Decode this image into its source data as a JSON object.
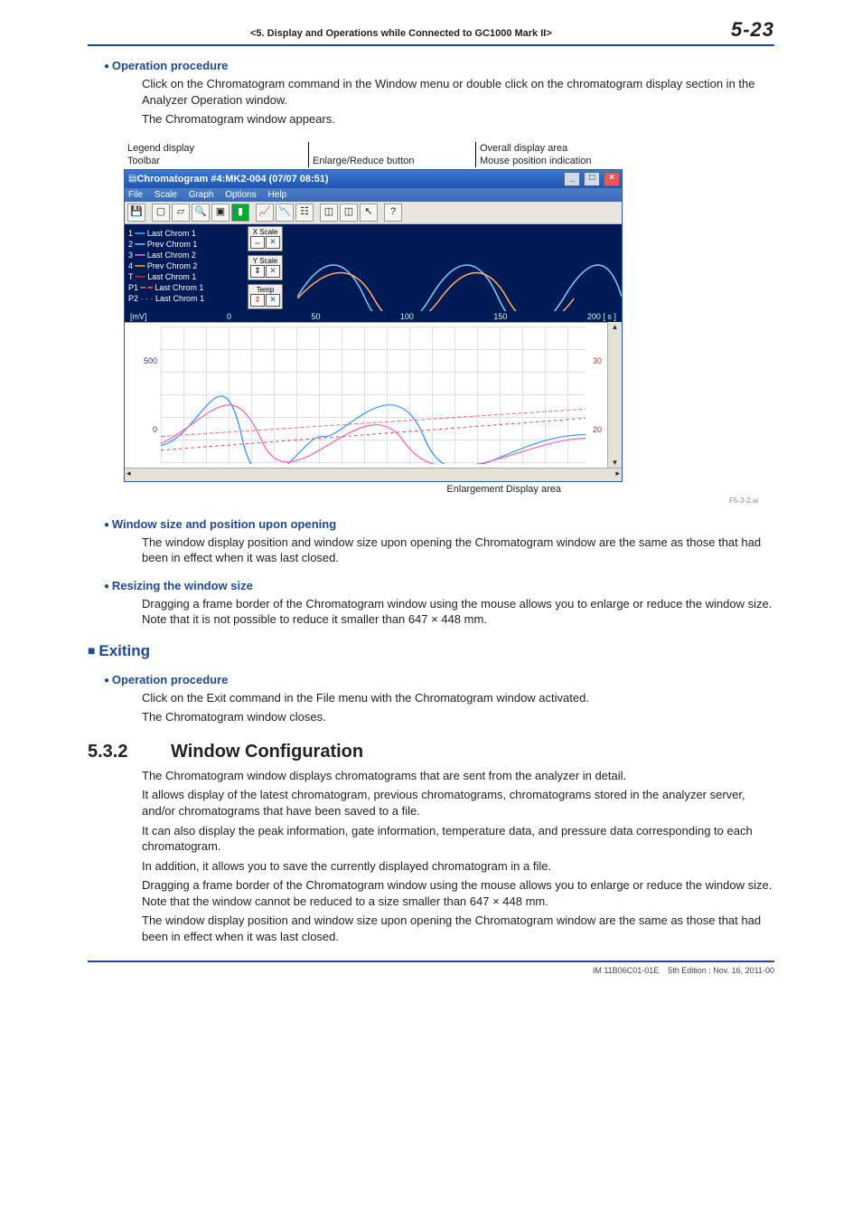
{
  "header": {
    "chapter": "<5.  Display and Operations while Connected to GC1000 Mark II>",
    "page": "5-23"
  },
  "s_op1": {
    "title": "Operation procedure",
    "p1": "Click on the Chromatogram command in the Window menu or double click on the chromatogram display section in the Analyzer Operation window.",
    "p2": "The Chromatogram window appears."
  },
  "callout": {
    "legend_display": "Legend display",
    "toolbar": "Toolbar",
    "enlarge_reduce": "Enlarge/Reduce button",
    "overall": "Overall display area",
    "mouse": "Mouse position indication",
    "enlarge_area": "Enlargement Display area"
  },
  "win": {
    "title": "Chromatogram #4:MK2-004 (07/07 08:51)",
    "menu": {
      "file": "File",
      "scale": "Scale",
      "graph": "Graph",
      "options": "Options",
      "help": "Help"
    },
    "scale": {
      "xscale": "X Scale",
      "yscale": "Y Scale",
      "temp": "Temp"
    },
    "legend": {
      "i1": "Last Chrom 1",
      "i2": "Prev Chrom 1",
      "i3": "Last Chrom 2",
      "i4": "Prev Chrom 2",
      "iT": "Last Chrom 1",
      "iP1": "Last Chrom 1",
      "iP2": "Last Chrom 1",
      "n1": "1",
      "n2": "2",
      "n3": "3",
      "n4": "4",
      "nT": "T",
      "nP1": "P1",
      "nP2": "P2"
    },
    "axis": {
      "unitL": "[mV]",
      "t0": "0",
      "t50": "50",
      "t100": "100",
      "t150": "150",
      "t200": "200",
      "unitR": "[ s ]",
      "y500": "500",
      "y0": "0",
      "r30": "30",
      "r20": "20"
    }
  },
  "fig": {
    "caption_enlarge": "Enlargement Display area",
    "id": "F5-3-2.ai"
  },
  "s_winsize": {
    "title": "Window size and position upon opening",
    "p": "The window display position and window size upon opening the Chromatogram window are the same as those that had been in effect when it was last closed."
  },
  "s_resize": {
    "title": "Resizing the window size",
    "p": "Dragging a frame border of the Chromatogram window using the mouse allows you to enlarge or reduce the window size. Note that it is not possible to reduce it smaller than 647 × 448 mm."
  },
  "s_exit": {
    "title": "Exiting",
    "op_title": "Operation procedure",
    "p1": "Click on the Exit command in the File menu with the Chromatogram window activated.",
    "p2": "The Chromatogram window closes."
  },
  "s_532": {
    "num": "5.3.2",
    "title": "Window Configuration",
    "p1": "The Chromatogram window displays chromatograms that are sent from the analyzer in detail.",
    "p2": "It allows display of the latest chromatogram, previous chromatograms, chromatograms stored in the analyzer server, and/or chromatograms that have been saved to a file.",
    "p3": "It can also display the peak information, gate information, temperature data, and pressure data corresponding to each chromatogram.",
    "p4": "In addition, it allows you to save the currently displayed chromatogram in a file.",
    "p5": "Dragging a frame border of the Chromatogram window using the mouse allows you to enlarge or reduce the window size. Note that the window cannot be reduced to a size smaller than 647 × 448 mm.",
    "p6": "The window display position and window size upon opening the Chromatogram window are the same as those that had been in effect when it was last closed."
  },
  "footer": {
    "doc": "IM 11B06C01-01E",
    "ed": "5th Edition : Nov. 16, 2011-00"
  }
}
